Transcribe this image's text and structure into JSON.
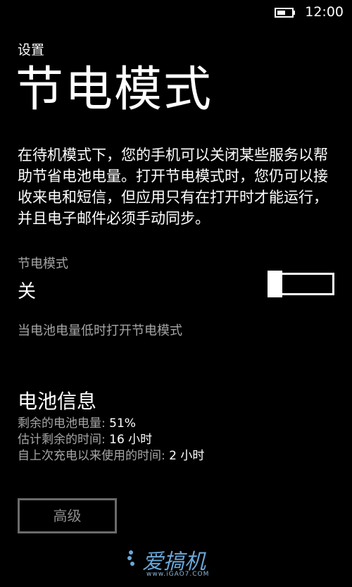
{
  "status_bar": {
    "battery_icon": "battery-icon",
    "time": "12:00"
  },
  "header": {
    "section": "设置",
    "title": "节电模式"
  },
  "description": "在待机模式下，您的手机可以关闭某些服务以帮助节省电池电量。打开节电模式时，您仍可以接收来电和短信，但应用只有在打开时才能运行，并且电子邮件必须手动同步。",
  "battery_saver": {
    "label": "节电模式",
    "state": "关",
    "enabled": false,
    "auto_option": "当电池电量低时打开节电模式"
  },
  "battery_info": {
    "heading": "电池信息",
    "remaining_label": "剩余的电池电量: ",
    "remaining_value": "51%",
    "estimated_label": "估计剩余的时间: ",
    "estimated_value": "16 小时",
    "since_charge_label": "自上次充电以来使用的时间: ",
    "since_charge_value": "2 小时"
  },
  "advanced_button": "高级",
  "watermark": {
    "text": "爱搞机",
    "url": "www.iGAO7.COM"
  },
  "colors": {
    "background": "#000000",
    "text": "#ffffff",
    "secondary_text": "#a6a6a6",
    "watermark": "#6aa7d8"
  }
}
